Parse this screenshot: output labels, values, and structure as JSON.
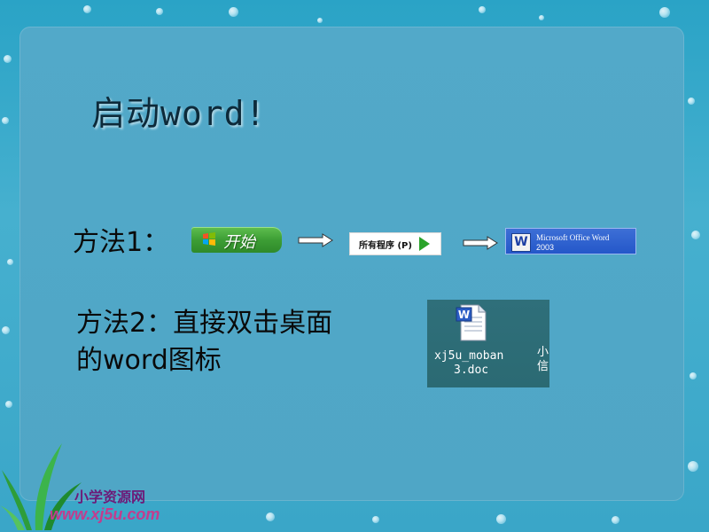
{
  "slide": {
    "title": "启动word!",
    "method1_label": "方法1：",
    "method2_line1": "方法2：直接双击桌面",
    "method2_line2": "的word图标"
  },
  "start_button": {
    "label": "开始"
  },
  "all_programs": {
    "label": "所有程序 (P)"
  },
  "office_item": {
    "line1": "Microsoft Office Word",
    "line2": "2003"
  },
  "desktop_icon": {
    "filename_line1": "xj5u_moban",
    "filename_line2": "3.doc",
    "side_line1": "小",
    "side_line2": "信"
  },
  "watermark": {
    "brand": "小学资源网",
    "url": "www.xj5u.com"
  },
  "icons": [
    "windows-flag-icon",
    "right-arrow-icon",
    "play-arrow-icon",
    "word-icon",
    "word-document-icon"
  ],
  "colors": {
    "background": "#46b0cf",
    "panel": "#52a9c9",
    "start_green": "#3d9e35",
    "office_blue": "#2457c9"
  }
}
